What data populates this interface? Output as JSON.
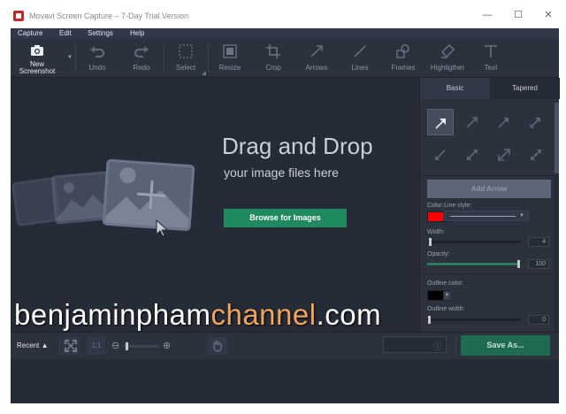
{
  "window": {
    "title": "Movavi Screen Capture – 7-Day Trial Version",
    "minimize": "—",
    "maximize": "☐",
    "close": "✕"
  },
  "menu": [
    "Capture",
    "Edit",
    "Settings",
    "Help"
  ],
  "toolbar": {
    "new_screenshot": "New\nScreenshot",
    "undo": "Undo",
    "redo": "Redo",
    "select": "Select",
    "resize": "Resize",
    "crop": "Crop",
    "arrows": "Arrows",
    "lines": "Lines",
    "frames": "Frames",
    "highlighter": "Highligther",
    "text": "Text"
  },
  "canvas": {
    "drag_title": "Drag and Drop",
    "drag_sub": "your image files here",
    "browse_label": "Browse for Images"
  },
  "watermark": {
    "part1": "benjaminpham",
    "part2": "channel",
    "part3": ".com"
  },
  "panel": {
    "tab_basic": "Basic",
    "tab_tapered": "Tapered",
    "add_arrow": "Add Arrow",
    "color_label": "Color:",
    "color_value": "#ff0000",
    "line_style_label": "Line style:",
    "width_label": "Width:",
    "width_value": "4",
    "opacity_label": "Opacity:",
    "opacity_value": "100",
    "outline_color_label": "Outline color:",
    "outline_color_value": "#000000",
    "outline_width_label": "Outline width:",
    "outline_width_value": "0"
  },
  "bottom": {
    "recent": "Recent ▲",
    "zoom_ratio": "1:1",
    "save_label": "Save As...",
    "info_icon": "ⓘ"
  },
  "colors": {
    "accent_green": "#1e8a5e",
    "bg_dark": "#262c37",
    "panel": "#2b313d",
    "watermark_orange": "#f0a45e"
  }
}
